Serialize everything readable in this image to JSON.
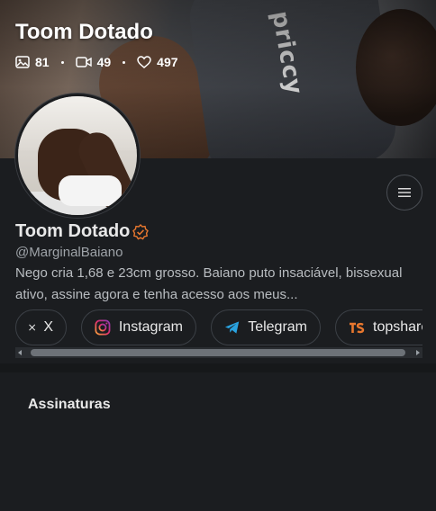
{
  "cover": {
    "title": "Toom Dotado",
    "brand_text": "priccy",
    "stats": [
      {
        "icon": "image-icon",
        "count": "81"
      },
      {
        "icon": "video-icon",
        "count": "49"
      },
      {
        "icon": "heart-icon",
        "count": "497"
      }
    ]
  },
  "profile": {
    "name": "Toom Dotado",
    "handle": "@MarginalBaiano",
    "bio": "Nego cria 1,68 e 23cm grosso. Baiano puto insaciável, bissexual ativo, assine agora e tenha acesso aos meus...",
    "accent_color": "#e8772e"
  },
  "links": [
    {
      "label": "X",
      "icon": "x-logo-icon"
    },
    {
      "label": "Instagram",
      "icon": "instagram-icon"
    },
    {
      "label": "Telegram",
      "icon": "telegram-icon"
    },
    {
      "label": "topshare",
      "icon": "topshare-icon"
    }
  ],
  "sections": {
    "subscriptions_title": "Assinaturas"
  }
}
